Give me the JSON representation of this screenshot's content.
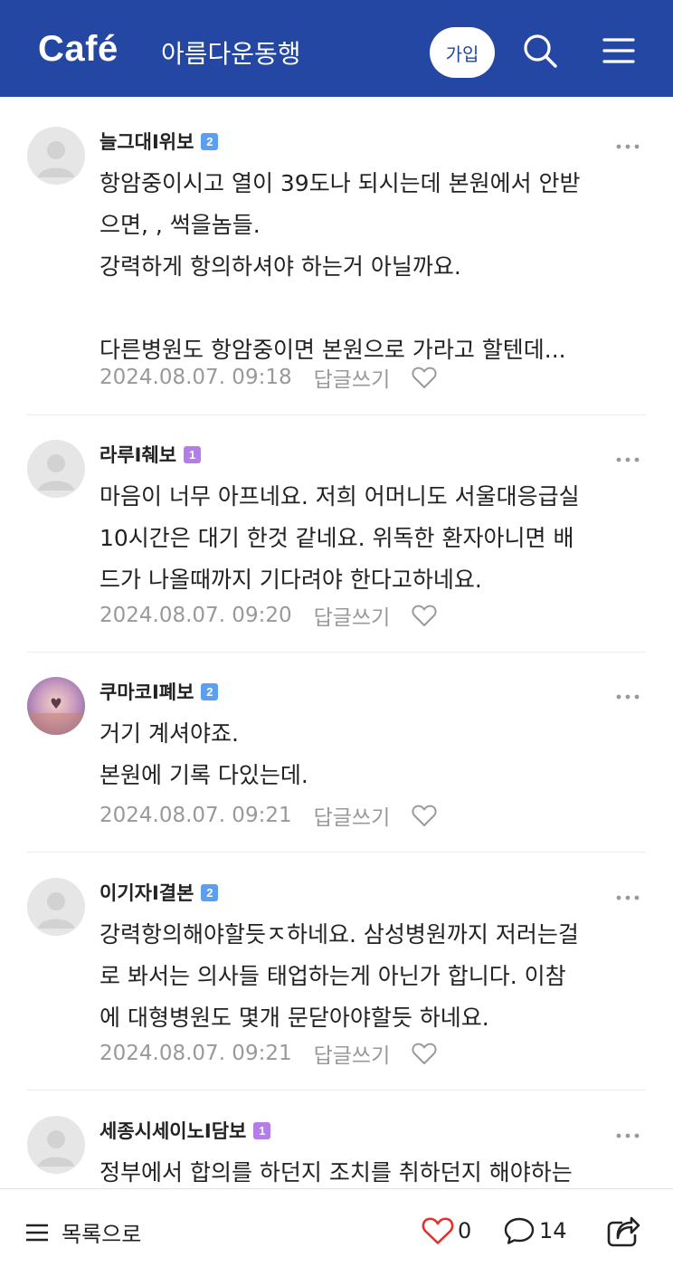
{
  "header": {
    "logo": "Café",
    "cafe_name": "아름다운동행",
    "join_label": "가입",
    "bg_color": "#2347A3"
  },
  "comments": [
    {
      "nickname": "늘그대I위보",
      "level": "2",
      "lines": [
        "항암중이시고 열이 39도나 되시는데 본원에서 안받",
        "으면, , 썩을놈들.",
        "강력하게 항의하셔야 하는거 아닐까요.",
        "",
        "다른병원도 항암중이면 본원으로 가라고 할텐데..."
      ],
      "date": "2024.08.07. 09:18",
      "reply_label": "답글쓰기"
    },
    {
      "nickname": "라루I췌보",
      "level": "1",
      "lines": [
        "마음이 너무 아프네요. 저희 어머니도 서울대응급실",
        "10시간은 대기 한것 같네요. 위독한 환자아니면 배",
        "드가 나올때까지 기다려야 한다고하네요."
      ],
      "date": "2024.08.07. 09:20",
      "reply_label": "답글쓰기"
    },
    {
      "nickname": "쿠마코I폐보",
      "level": "2",
      "lines": [
        "거기 계셔야죠.",
        "본원에 기록 다있는데."
      ],
      "date": "2024.08.07. 09:21",
      "reply_label": "답글쓰기"
    },
    {
      "nickname": "이기자I결본",
      "level": "2",
      "lines": [
        "강력항의해야할듯ㅈ하네요. 삼성병원까지 저러는걸",
        "로 봐서는 의사들 태업하는게 아닌가 합니다. 이참",
        "에 대형병원도 몇개 문닫아야할듯 하네요."
      ],
      "date": "2024.08.07. 09:21",
      "reply_label": "답글쓰기"
    },
    {
      "nickname": "세종시세이노I담보",
      "level": "1",
      "lines": [
        "정부에서 합의를 하던지 조치를 취하던지 해야하는"
      ],
      "date": "",
      "reply_label": ""
    }
  ],
  "bottom_bar": {
    "list_label": "목록으로",
    "like_count": "0",
    "comment_count": "14"
  },
  "icons": [
    "search-icon",
    "hamburger-menu-icon",
    "more-dots-icon",
    "heart-icon",
    "speech-bubble-icon",
    "share-icon",
    "list-icon",
    "default-avatar-icon"
  ]
}
